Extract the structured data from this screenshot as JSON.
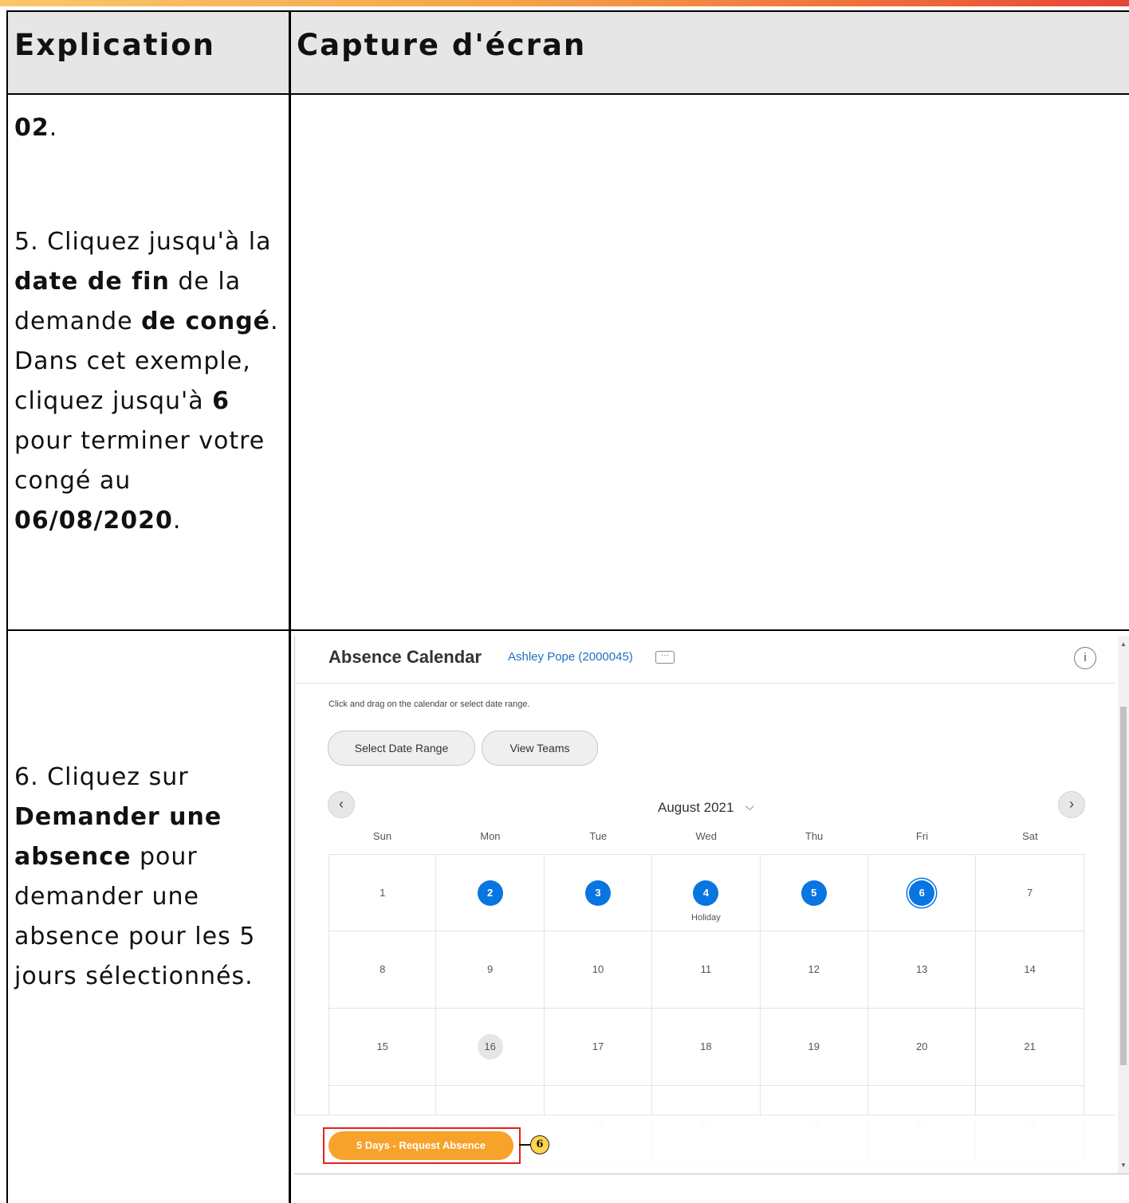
{
  "document": {
    "headers": {
      "explanation": "Explication",
      "screenshot": "Capture d'écran"
    },
    "row1": {
      "prefix_bold": "02",
      "prefix_tail": ".",
      "p1": "5. Cliquez jusqu'à la ",
      "b1": "date de fin",
      "p2": " de la demande ",
      "b2": "de congé",
      "p3": ". Dans cet exemple, cliquez jusqu'à ",
      "b3": "6",
      "p4": " pour terminer votre congé au ",
      "b4": "06/08/2020",
      "p5": "."
    },
    "row2": {
      "p1": "6. Cliquez sur ",
      "b1": "Demander une absence",
      "p2": " pour demander une absence pour les 5 jours sélectionnés."
    }
  },
  "screenshot": {
    "title": "Absence Calendar",
    "worker": "Ashley Pope (2000045)",
    "more_icon": "···",
    "info_icon": "i",
    "instruction": "Click and drag on the calendar or select date range.",
    "buttons": {
      "select_date_range": "Select Date Range",
      "view_teams": "View Teams"
    },
    "nav": {
      "prev": "‹",
      "next": "›"
    },
    "month": "August 2021",
    "month_chevron": "⌵",
    "day_names": [
      "Sun",
      "Mon",
      "Tue",
      "Wed",
      "Thu",
      "Fri",
      "Sat"
    ],
    "weeks": [
      [
        "1",
        "2",
        "3",
        "4",
        "5",
        "6",
        "7"
      ],
      [
        "8",
        "9",
        "10",
        "11",
        "12",
        "13",
        "14"
      ],
      [
        "15",
        "16",
        "17",
        "18",
        "19",
        "20",
        "21"
      ],
      [
        "22",
        "23",
        "24",
        "25",
        "26",
        "27",
        "28"
      ]
    ],
    "selected_days": [
      "2",
      "3",
      "4",
      "5",
      "6"
    ],
    "focused_day": "6",
    "today_day": "16",
    "holiday": {
      "day": "4",
      "label": "Holiday"
    },
    "request_button": "5 Days - Request Absence",
    "callout_number": "6",
    "colors": {
      "accent": "#0875e1",
      "request": "#f7a22a",
      "highlight": "#e2231a",
      "link": "#1f6fc2"
    }
  }
}
